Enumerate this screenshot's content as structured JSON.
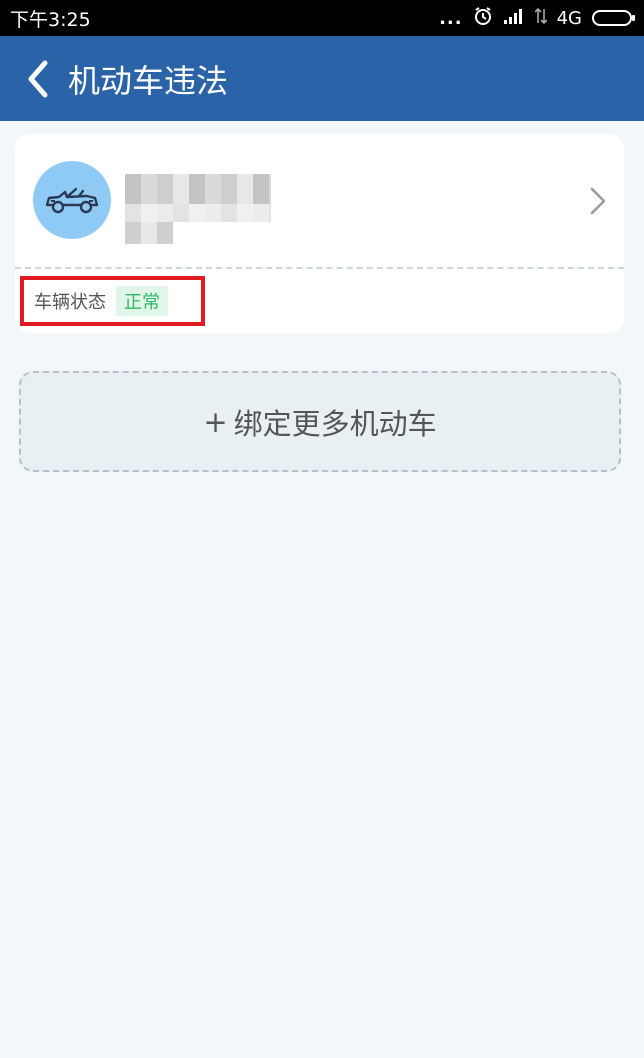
{
  "status_bar": {
    "time": "下午3:25",
    "dots": "...",
    "network": "4G",
    "icons": [
      "alarm-icon",
      "signal-icon",
      "data-arrows-icon",
      "battery-icon"
    ]
  },
  "header": {
    "title": "机动车违法",
    "background_color": "#2b63a8"
  },
  "vehicle": {
    "status_label": "车辆状态",
    "status_value": "正常",
    "status_color": "#2fb868",
    "avatar_color": "#8fcaf5"
  },
  "bind_more": {
    "plus": "+",
    "label": "绑定更多机动车"
  },
  "colors": {
    "highlight_box": "#e11b22"
  }
}
